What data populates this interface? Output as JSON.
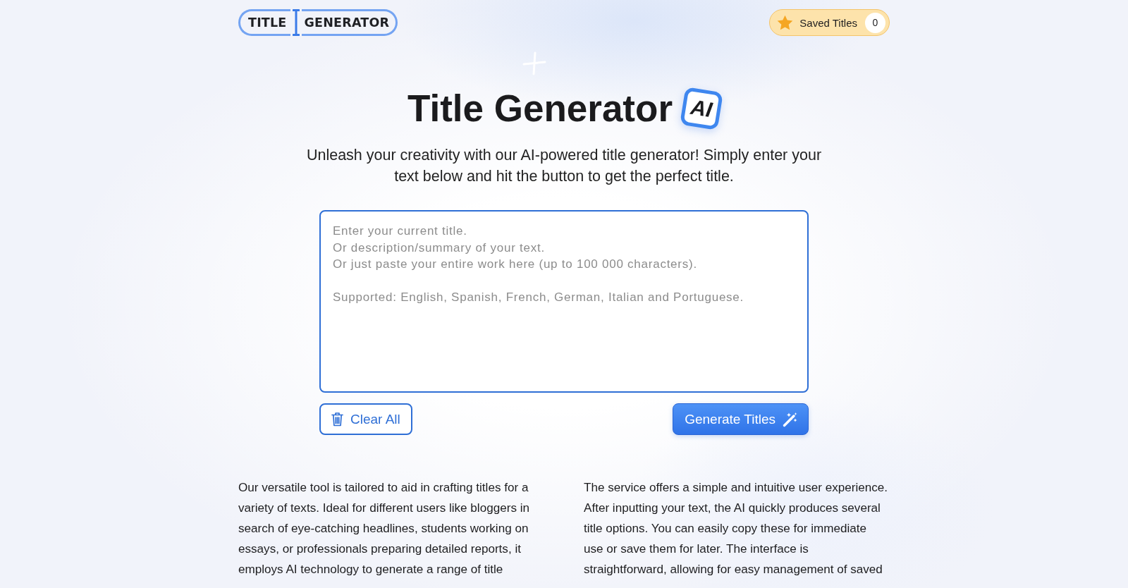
{
  "header": {
    "logo": {
      "left_text": "TITLE",
      "right_text": "GENERATOR"
    },
    "saved_titles": {
      "label": "Saved Titles",
      "count": "0"
    }
  },
  "hero": {
    "title": "Title Generator",
    "badge": "AI",
    "subtitle": "Unleash your creativity with our AI-powered title generator! Simply enter your text below and hit the button to get the perfect title."
  },
  "input": {
    "placeholder": "Enter your current title.\nOr description/summary of your text.\nOr just paste your entire work here (up to 100 000 characters).\n\nSupported: English, Spanish, French, German, Italian and Portuguese."
  },
  "buttons": [
    {
      "label": "Clear All",
      "kind": "outline"
    },
    {
      "label": "Generate Titles",
      "kind": "primary"
    }
  ],
  "description": {
    "paragraphs": [
      "Our versatile tool is tailored to aid in crafting titles for a variety of texts. Ideal for different users like bloggers in search of eye-catching headlines, students working on essays, or professionals preparing detailed reports, it employs AI technology to generate a range of title",
      "The service offers a simple and intuitive user experience. After inputting your text, the AI quickly produces several title options. You can easily copy these for immediate use or save them for later. The interface is straightforward, allowing for easy management of saved"
    ]
  }
}
